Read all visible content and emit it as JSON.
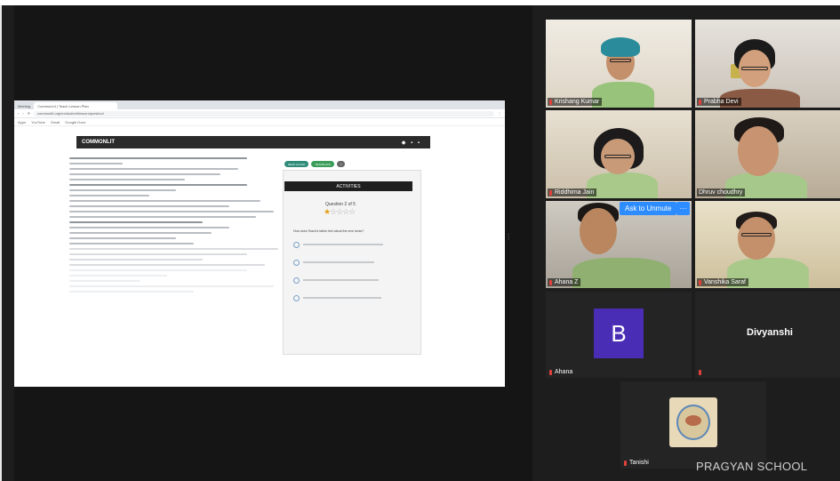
{
  "browser": {
    "tabs": [
      "Meeting",
      "CommonLit | Teach Lesson Plan"
    ],
    "url": "commonlit.org/en/student/lesson/question/",
    "bookmarks": [
      "Apps",
      "YouTube",
      "Gmail",
      "Google Docs"
    ]
  },
  "commonlit": {
    "logo": "COMMONLIT",
    "header_right": "◆ ▪ ▪",
    "buttons": [
      "READ ALOUD",
      "TRANSLATE",
      "?"
    ],
    "activities_title": "ACTIVITIES",
    "question_label": "Question 2 of 5",
    "rating": "★☆☆☆☆",
    "question_text": "How does Teach's father feel about the new horse?"
  },
  "participants": [
    {
      "name": "Krishang Kumar"
    },
    {
      "name": "Prabha Devi"
    },
    {
      "name": "Riddhima Jain"
    },
    {
      "name": "Dhruv choudhry"
    },
    {
      "name": "Ahana Z"
    },
    {
      "name": "Vanshika Saraf"
    },
    {
      "name": "Ahana"
    },
    {
      "name": ""
    },
    {
      "name": "Tanishi"
    }
  ],
  "avatar_letter": "B",
  "divyanshi_label": "Divyanshi",
  "ask_to_unmute": "Ask to Unmute",
  "more_label": "···",
  "watermark": "PRAGYAN SCHOOL",
  "colors": {
    "zoom_blue": "#2d8cff",
    "speaker_green": "#a6d46a",
    "avatar_purple": "#4a2db5",
    "mic_red": "#e0413a"
  }
}
